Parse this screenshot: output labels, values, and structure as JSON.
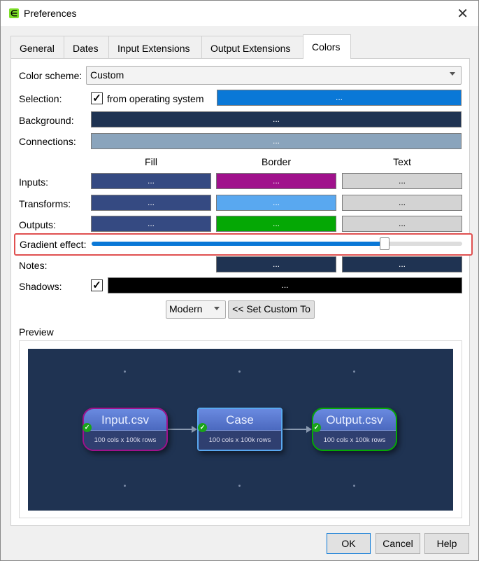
{
  "window": {
    "title": "Preferences"
  },
  "tabs": [
    {
      "label": "General"
    },
    {
      "label": "Dates"
    },
    {
      "label": "Input Extensions"
    },
    {
      "label": "Output Extensions"
    },
    {
      "label": "Colors",
      "active": true
    }
  ],
  "color_scheme": {
    "label": "Color scheme:",
    "value": "Custom"
  },
  "selection": {
    "label": "Selection:",
    "checkbox_label": "from operating system",
    "checked": true,
    "color": "#0a78d7",
    "button": "..."
  },
  "background": {
    "label": "Background:",
    "color": "#1f3352",
    "button": "..."
  },
  "connections": {
    "label": "Connections:",
    "color": "#8aa4bc",
    "button": "..."
  },
  "columns": {
    "fill": "Fill",
    "border": "Border",
    "text": "Text"
  },
  "rows": {
    "inputs": {
      "label": "Inputs:",
      "fill": "#354a82",
      "border": "#a0118c",
      "text": "#d3d3d3"
    },
    "transforms": {
      "label": "Transforms:",
      "fill": "#354a82",
      "border": "#59a8f0",
      "text": "#d3d3d3"
    },
    "outputs": {
      "label": "Outputs:",
      "fill": "#354a82",
      "border": "#05a805",
      "text": "#d3d3d3"
    },
    "notes": {
      "label": "Notes:",
      "border": "#1f3352",
      "text": "#1f3352"
    }
  },
  "swatch_button": "...",
  "gradient": {
    "label": "Gradient effect:",
    "value": 0.79
  },
  "shadows": {
    "label": "Shadows:",
    "checked": true,
    "color": "#000000",
    "button": "..."
  },
  "preset": {
    "value": "Modern",
    "set_button": "<< Set Custom To"
  },
  "preview": {
    "label": "Preview",
    "nodes": [
      {
        "title": "Input.csv",
        "info": "100 cols x 100k rows"
      },
      {
        "title": "Case",
        "info": "100 cols x 100k rows"
      },
      {
        "title": "Output.csv",
        "info": "100 cols x 100k rows"
      }
    ]
  },
  "buttons": {
    "ok": "OK",
    "cancel": "Cancel",
    "help": "Help"
  }
}
